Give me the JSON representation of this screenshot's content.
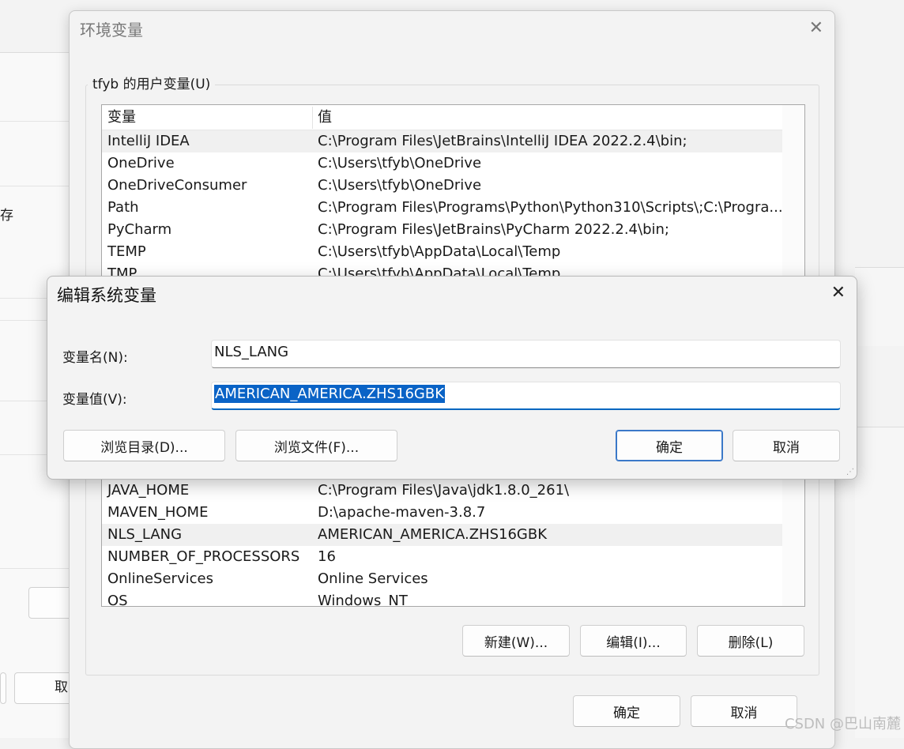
{
  "background": {
    "fragment_text": "存",
    "fragment_button": "取"
  },
  "env_dialog": {
    "title": "环境变量",
    "user_group_title": "tfyb 的用户变量(U)",
    "user_columns": [
      "变量",
      "值"
    ],
    "user_rows": [
      {
        "name": "IntelliJ IDEA",
        "value": "C:\\Program Files\\JetBrains\\IntelliJ IDEA 2022.2.4\\bin;"
      },
      {
        "name": "OneDrive",
        "value": "C:\\Users\\tfyb\\OneDrive"
      },
      {
        "name": "OneDriveConsumer",
        "value": "C:\\Users\\tfyb\\OneDrive"
      },
      {
        "name": "Path",
        "value": "C:\\Program Files\\Programs\\Python\\Python310\\Scripts\\;C:\\Progra..."
      },
      {
        "name": "PyCharm",
        "value": "C:\\Program Files\\JetBrains\\PyCharm 2022.2.4\\bin;"
      },
      {
        "name": "TEMP",
        "value": "C:\\Users\\tfyb\\AppData\\Local\\Temp"
      },
      {
        "name": "TMP",
        "value": "C:\\Users\\tfyb\\AppData\\Local\\Temp"
      }
    ],
    "system_rows": [
      {
        "name": "JAVA_HOME",
        "value": "C:\\Program Files\\Java\\jdk1.8.0_261\\"
      },
      {
        "name": "MAVEN_HOME",
        "value": "D:\\apache-maven-3.8.7"
      },
      {
        "name": "NLS_LANG",
        "value": "AMERICAN_AMERICA.ZHS16GBK"
      },
      {
        "name": "NUMBER_OF_PROCESSORS",
        "value": "16"
      },
      {
        "name": "OnlineServices",
        "value": "Online Services"
      },
      {
        "name": "OS",
        "value": "Windows_NT"
      }
    ],
    "buttons": {
      "new": "新建(W)...",
      "edit": "编辑(I)...",
      "delete": "删除(L)",
      "ok": "确定",
      "cancel": "取消"
    }
  },
  "edit_dialog": {
    "title": "编辑系统变量",
    "name_label": "变量名(N):",
    "value_label": "变量值(V):",
    "name_value": "NLS_LANG",
    "value_value": "AMERICAN_AMERICA.ZHS16GBK",
    "buttons": {
      "browse_dir": "浏览目录(D)...",
      "browse_file": "浏览文件(F)...",
      "ok": "确定",
      "cancel": "取消"
    }
  },
  "watermark": "CSDN @巴山南麓",
  "icons": {
    "close": "close-icon",
    "resize_grip": "resize-grip-icon"
  },
  "colors": {
    "accent": "#0067c0",
    "selection": "#0a63c6"
  }
}
